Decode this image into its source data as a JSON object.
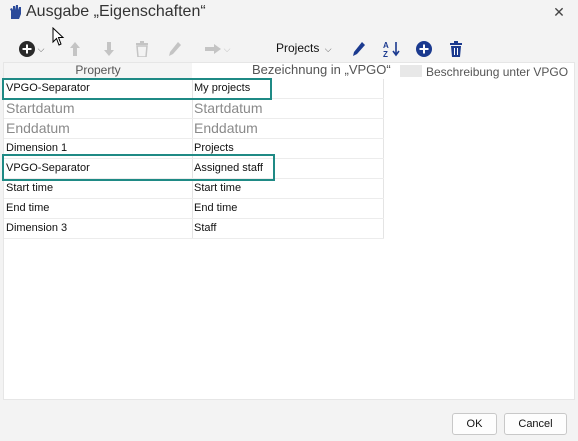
{
  "window": {
    "title": "Ausgabe „Eigenschaften“",
    "close_glyph": "✕"
  },
  "toolbar": {
    "projects_dropdown": "Projects",
    "icons": [
      "add-circle-icon",
      "arrow-up-icon",
      "arrow-down-icon",
      "trash-icon",
      "pencil-icon",
      "arrow-right-icon",
      "edit-icon",
      "sort-az-icon",
      "add-circle-icon",
      "trash-icon"
    ],
    "caret": "⌵"
  },
  "grid": {
    "headers": {
      "property": "Property",
      "vpgo": "Bezeichnung in „VPGO“",
      "description": "Beschreibung unter VPGO"
    },
    "rows": [
      {
        "property": "VPGO-Separator",
        "vpgo": "My projects",
        "large": false
      },
      {
        "property": "Startdatum",
        "vpgo": "Startdatum",
        "large": true
      },
      {
        "property": "Enddatum",
        "vpgo": "Enddatum",
        "large": true
      },
      {
        "property": "Dimension 1",
        "vpgo": "Projects",
        "large": false
      },
      {
        "property": "VPGO-Separator",
        "vpgo": "Assigned staff",
        "large": false
      },
      {
        "property": "Start time",
        "vpgo": "Start time",
        "large": false
      },
      {
        "property": "End time",
        "vpgo": "End time",
        "large": false
      },
      {
        "property": "Dimension 3",
        "vpgo": "Staff",
        "large": false
      }
    ]
  },
  "buttons": {
    "ok": "OK",
    "cancel": "Cancel"
  },
  "colors": {
    "highlight": "#1f8a85",
    "icon_blue": "#1b3a8f",
    "icon_disabled": "#c4c4c4"
  }
}
